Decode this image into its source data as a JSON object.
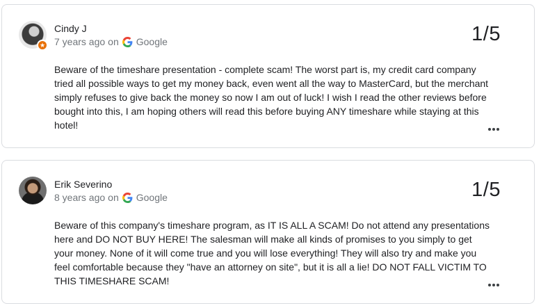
{
  "reviews": [
    {
      "name": "Cindy J",
      "time": "7 years ago",
      "on": "on",
      "source": "Google",
      "rating": "1/5",
      "badge_icon": "local-guide-star-icon",
      "text": "Beware of the timeshare presentation - complete scam! The worst part is, my credit card company tried all possible ways to get my money back, even went all the way to MasterCard, but the merchant simply refuses to give back the money so now I am out of luck! I wish I read the other reviews before bought into this, I am hoping others will read this before buying ANY timeshare while staying at this hotel!"
    },
    {
      "name": "Erik Severino",
      "time": "8 years ago",
      "on": "on",
      "source": "Google",
      "rating": "1/5",
      "text": "Beware of this company's timeshare program, as IT IS ALL A SCAM! Do not attend any presentations here and DO NOT BUY HERE! The salesman will make all kinds of promises to you simply to get your money. None of it will come true and you will lose everything! They will also try and make you feel comfortable because they \"have an attorney on site\", but it is all a lie! DO NOT FALL VICTIM TO THIS TIMESHARE SCAM!"
    }
  ],
  "colors": {
    "card_border": "#dadce0",
    "meta_text": "#70757a",
    "primary_text": "#202124",
    "guide_badge": "#e8710a"
  }
}
